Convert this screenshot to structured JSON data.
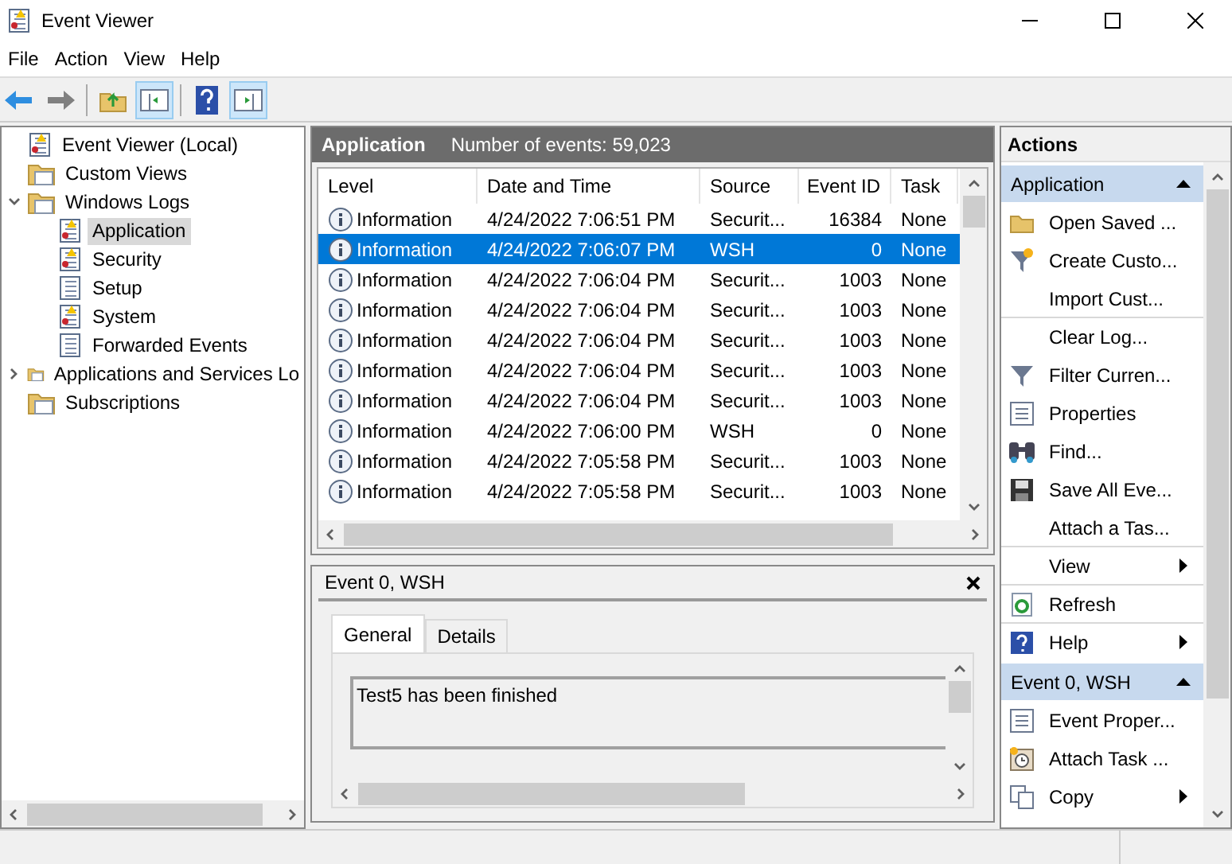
{
  "window": {
    "title": "Event Viewer"
  },
  "menu": [
    "File",
    "Action",
    "View",
    "Help"
  ],
  "toolbar": {
    "console_tree_on": true,
    "action_pane_on": true
  },
  "tree": [
    {
      "label": "Event Viewer (Local)",
      "kind": "root",
      "selected": false,
      "children": [
        {
          "label": "Custom Views",
          "kind": "folder",
          "selected": false
        },
        {
          "label": "Windows Logs",
          "kind": "folder",
          "selected": false,
          "expanded": true,
          "children": [
            {
              "label": "Application",
              "kind": "log",
              "selected": true
            },
            {
              "label": "Security",
              "kind": "log",
              "selected": false
            },
            {
              "label": "Setup",
              "kind": "log",
              "selected": false
            },
            {
              "label": "System",
              "kind": "log",
              "selected": false
            },
            {
              "label": "Forwarded Events",
              "kind": "log",
              "selected": false
            }
          ]
        },
        {
          "label": "Applications and Services Lo",
          "kind": "folder",
          "selected": false,
          "expanded": false
        },
        {
          "label": "Subscriptions",
          "kind": "folder",
          "selected": false
        }
      ]
    }
  ],
  "log_header": {
    "title": "Application",
    "summary": "Number of events: 59,023"
  },
  "table": {
    "columns": [
      "Level",
      "Date and Time",
      "Source",
      "Event ID",
      "Task"
    ],
    "rows": [
      {
        "cells": [
          "Information",
          "4/24/2022 7:06:51 PM",
          "Securit...",
          "16384",
          "None"
        ],
        "selected": false
      },
      {
        "cells": [
          "Information",
          "4/24/2022 7:06:07 PM",
          "WSH",
          "0",
          "None"
        ],
        "selected": true
      },
      {
        "cells": [
          "Information",
          "4/24/2022 7:06:04 PM",
          "Securit...",
          "1003",
          "None"
        ],
        "selected": false
      },
      {
        "cells": [
          "Information",
          "4/24/2022 7:06:04 PM",
          "Securit...",
          "1003",
          "None"
        ],
        "selected": false
      },
      {
        "cells": [
          "Information",
          "4/24/2022 7:06:04 PM",
          "Securit...",
          "1003",
          "None"
        ],
        "selected": false
      },
      {
        "cells": [
          "Information",
          "4/24/2022 7:06:04 PM",
          "Securit...",
          "1003",
          "None"
        ],
        "selected": false
      },
      {
        "cells": [
          "Information",
          "4/24/2022 7:06:04 PM",
          "Securit...",
          "1003",
          "None"
        ],
        "selected": false
      },
      {
        "cells": [
          "Information",
          "4/24/2022 7:06:00 PM",
          "WSH",
          "0",
          "None"
        ],
        "selected": false
      },
      {
        "cells": [
          "Information",
          "4/24/2022 7:05:58 PM",
          "Securit...",
          "1003",
          "None"
        ],
        "selected": false
      },
      {
        "cells": [
          "Information",
          "4/24/2022 7:05:58 PM",
          "Securit...",
          "1003",
          "None"
        ],
        "selected": false
      }
    ]
  },
  "detail": {
    "title": "Event 0, WSH",
    "tabs": [
      {
        "label": "General",
        "selected": true
      },
      {
        "label": "Details",
        "selected": false
      }
    ],
    "message": "Test5 has been finished"
  },
  "actions": {
    "title": "Actions",
    "sections": [
      {
        "title": "Application",
        "expanded": true,
        "items": [
          {
            "label": "Open Saved ...",
            "submenu": false,
            "separator_before": false
          },
          {
            "label": "Create Custo...",
            "submenu": false,
            "separator_before": false
          },
          {
            "label": "Import Cust...",
            "submenu": false,
            "separator_before": false
          },
          {
            "label": "Clear Log...",
            "submenu": false,
            "separator_before": true
          },
          {
            "label": "Filter Curren...",
            "submenu": false,
            "separator_before": false
          },
          {
            "label": "Properties",
            "submenu": false,
            "separator_before": false
          },
          {
            "label": "Find...",
            "submenu": false,
            "separator_before": false
          },
          {
            "label": "Save All Eve...",
            "submenu": false,
            "separator_before": false
          },
          {
            "label": "Attach a Tas...",
            "submenu": false,
            "separator_before": false
          },
          {
            "label": "View",
            "submenu": true,
            "separator_before": true
          },
          {
            "label": "Refresh",
            "submenu": false,
            "separator_before": true
          },
          {
            "label": "Help",
            "submenu": true,
            "separator_before": true
          }
        ]
      },
      {
        "title": "Event 0, WSH",
        "expanded": true,
        "items": [
          {
            "label": "Event Proper...",
            "submenu": false,
            "separator_before": false
          },
          {
            "label": "Attach Task ...",
            "submenu": false,
            "separator_before": false
          },
          {
            "label": "Copy",
            "submenu": true,
            "separator_before": false
          }
        ]
      }
    ]
  }
}
